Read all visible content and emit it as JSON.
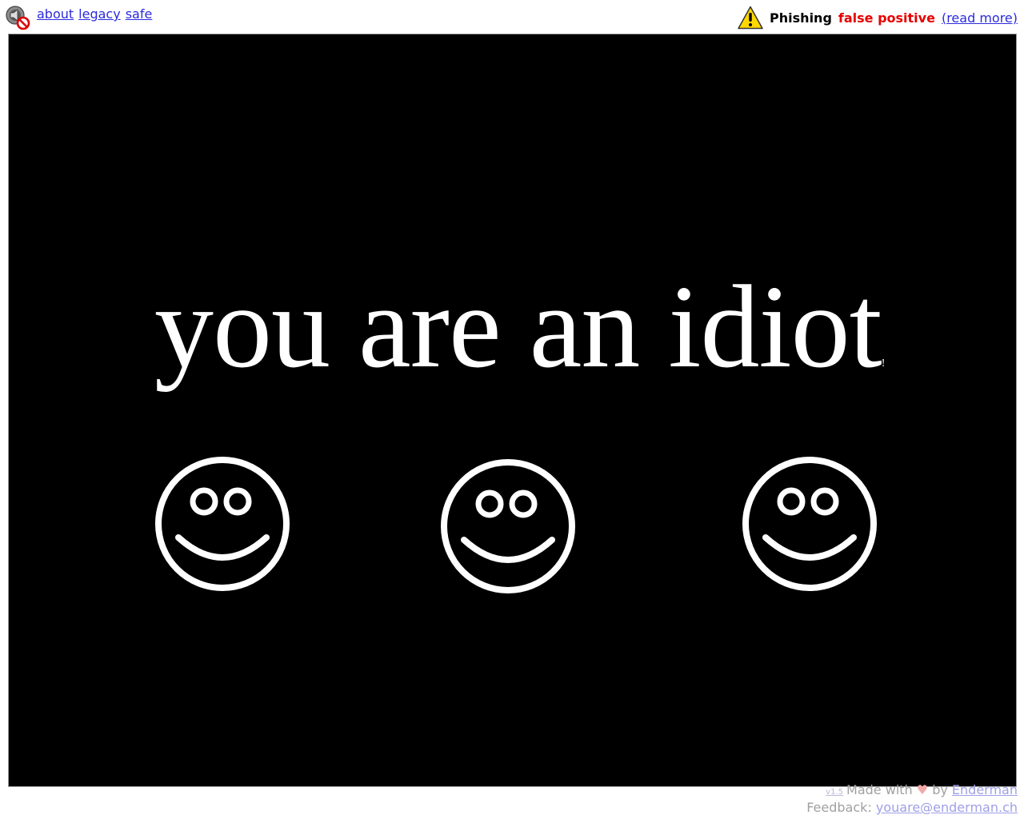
{
  "nav": {
    "about": "about",
    "legacy": "legacy",
    "safe": "safe"
  },
  "notice": {
    "prefix": "Phishing",
    "highlight": "false positive",
    "link": "(read more)"
  },
  "main": {
    "headline": "you are an idiot",
    "exclamation": "!"
  },
  "footer": {
    "version": "v1.5",
    "made_with": "Made with",
    "heart": "♥",
    "by": "by",
    "author": "Enderman",
    "feedback_label": "Feedback:",
    "email": "youare@enderman.ch"
  },
  "icons": {
    "sound": "speaker-muted-icon",
    "warning": "warning-icon",
    "smiley": "smiley-face-icon"
  },
  "colors": {
    "stage_bg": "#000000",
    "link": "#2b2bdc",
    "alert_red": "#e60000",
    "warning_yellow": "#ffd800"
  }
}
